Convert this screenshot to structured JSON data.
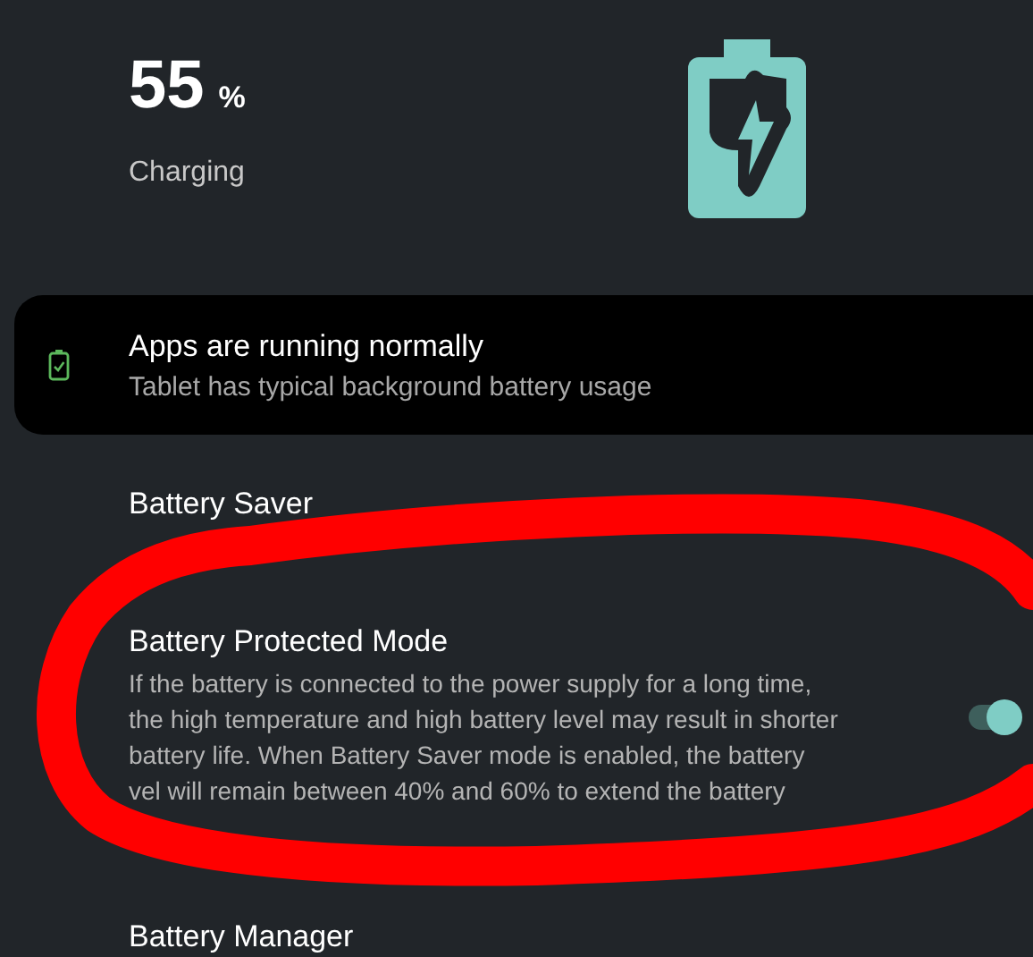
{
  "battery": {
    "percent": "55",
    "unit": "%",
    "status": "Charging"
  },
  "status_card": {
    "title": "Apps are running normally",
    "subtitle": "Tablet has typical background battery usage"
  },
  "settings": [
    {
      "kind": "plain",
      "title": "Battery Saver"
    },
    {
      "kind": "toggle",
      "title": "Battery Protected Mode",
      "description": "If the battery is connected to the power supply for a long time,\nthe high temperature and high battery level may result in shorter\nbattery life. When Battery Saver mode is enabled, the battery\nvel will remain between 40% and 60% to extend the battery",
      "on": true
    },
    {
      "kind": "plain",
      "title": "Battery Manager"
    }
  ],
  "annotation": {
    "kind": "circle"
  }
}
